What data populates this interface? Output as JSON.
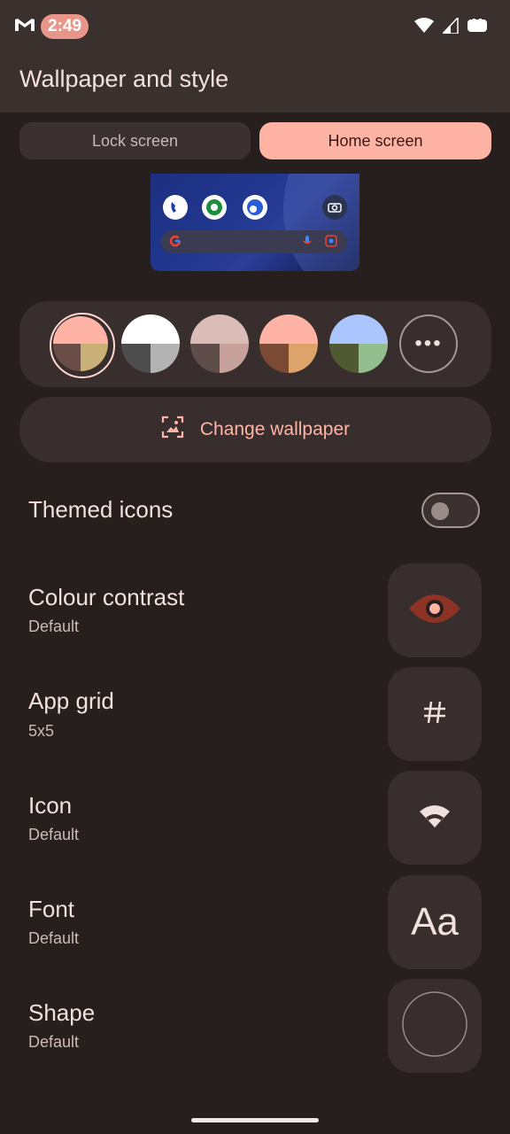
{
  "status": {
    "time": "2:49"
  },
  "header": {
    "title": "Wallpaper and style"
  },
  "tabs": [
    {
      "label": "Lock screen",
      "selected": false
    },
    {
      "label": "Home screen",
      "selected": true
    }
  ],
  "colors": {
    "accent": "#ffb3a5",
    "swatches": [
      {
        "top": "#ffb3a5",
        "bottom_left": "#6b4d48",
        "bottom_right": "#c9b077",
        "selected": true
      },
      {
        "top": "#ffffff",
        "bottom_left": "#4d4d4d",
        "bottom_right": "#b3b3b3"
      },
      {
        "top": "#dbbdb8",
        "bottom_left": "#5f4d4a",
        "bottom_right": "#c7a29c"
      },
      {
        "top": "#ffb3a5",
        "bottom_left": "#7a4a35",
        "bottom_right": "#dca36a"
      },
      {
        "top": "#abc6ff",
        "bottom_left": "#4f5a32",
        "bottom_right": "#93bf8e"
      }
    ]
  },
  "change_wallpaper": {
    "label": "Change wallpaper",
    "icon": "wallpaper-icon"
  },
  "themed_icons": {
    "label": "Themed icons",
    "enabled": false
  },
  "options": [
    {
      "title": "Colour contrast",
      "value": "Default",
      "icon": "eye-icon"
    },
    {
      "title": "App grid",
      "value": "5x5",
      "icon": "grid-icon"
    },
    {
      "title": "Icon",
      "value": "Default",
      "icon": "wifi-shape-icon"
    },
    {
      "title": "Font",
      "value": "Default",
      "icon": "font-icon",
      "sample": "Aa"
    },
    {
      "title": "Shape",
      "value": "Default",
      "icon": "circle-shape-icon"
    }
  ]
}
